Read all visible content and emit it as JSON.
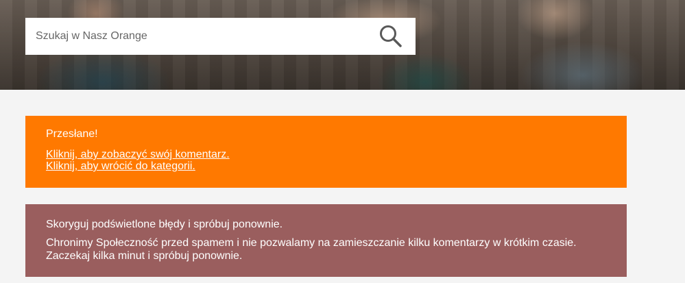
{
  "search": {
    "placeholder": "Szukaj w Nasz Orange",
    "icon": "search-icon"
  },
  "success_alert": {
    "title": "Przesłane!",
    "links": [
      "Kliknij, aby zobaczyć swój komentarz.",
      "Kliknij, aby wrócić do kategorii."
    ],
    "color": "#ff7900"
  },
  "error_alert": {
    "title": "Skoryguj podświetlone błędy i spróbuj ponownie.",
    "message": "Chronimy Społeczność przed spamem i nie pozwalamy na zamieszczanie kilku komentarzy w krótkim czasie. Zaczekaj kilka minut i spróbuj ponownie.",
    "color": "#9a5e5e"
  }
}
